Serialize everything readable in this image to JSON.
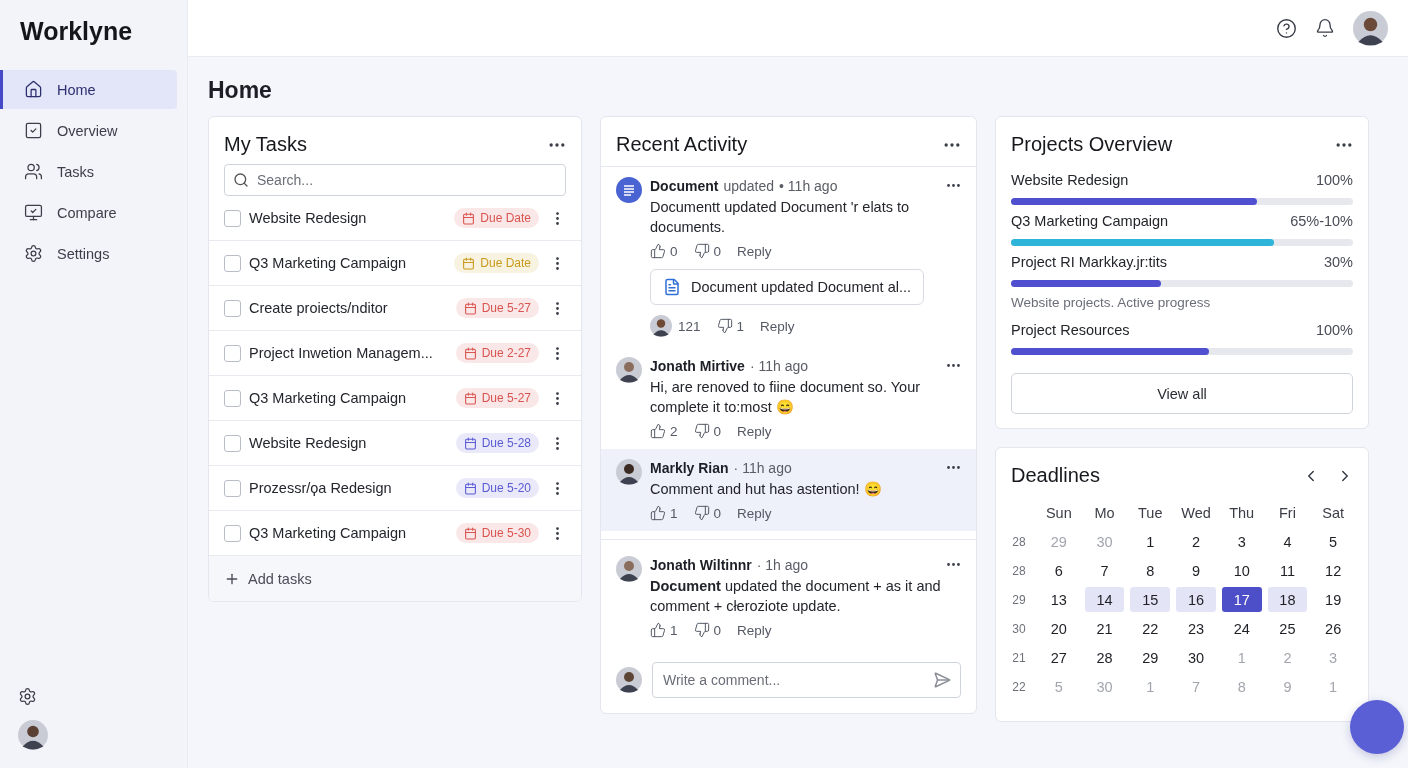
{
  "brand": "Worklyne",
  "nav": [
    {
      "label": "Home",
      "selected": true
    },
    {
      "label": "Overview",
      "selected": false
    },
    {
      "label": "Tasks",
      "selected": false
    },
    {
      "label": "Compare",
      "selected": false
    },
    {
      "label": "Settings",
      "selected": false
    }
  ],
  "page_title": "Home",
  "tasks": {
    "title": "My Tasks",
    "search": {
      "placeholder": "Search..."
    },
    "items": [
      {
        "name": "Website Redesign",
        "due": "Due Date",
        "color": "#d9534f",
        "checked": false
      },
      {
        "name": "Q3 Marketing Campaign",
        "due": "Due Date",
        "color": "#c99a1c",
        "checked": false
      },
      {
        "name": "Create proiects/nditor",
        "due": "Due 5-27",
        "color": "#d9534f",
        "checked": false
      },
      {
        "name": "Project Inwetion Managem...",
        "due": "Due 2-27",
        "color": "#d9534f",
        "checked": false
      },
      {
        "name": "Q3 Marketing Campaign",
        "due": "Due 5-27",
        "color": "#d9534f",
        "checked": false
      },
      {
        "name": "Website Redesign",
        "due": "Due 5-28",
        "color": "#5b5bd6",
        "checked": false
      },
      {
        "name": "Prozessr/ϙa Redesign",
        "due": "Due 5-20",
        "color": "#5b5bd6",
        "checked": false
      },
      {
        "name": "Q3 Marketing Campaign",
        "due": "Due 5-30",
        "color": "#d9534f",
        "checked": false
      }
    ],
    "add_label": "Add tasks"
  },
  "activity": {
    "title": "Recent Activity",
    "items": [
      {
        "kind": "document",
        "author": "Document",
        "action": "updated",
        "time": "• 11h ago",
        "text": "Documentt updated Document 'r elats to documents.",
        "likes": "0",
        "dislikes": "0",
        "reply": "Reply",
        "highlighted": false,
        "attachment": "Document updated Document al...",
        "sub": {
          "likes": "121",
          "dislikes": "1",
          "reply": "Reply"
        }
      },
      {
        "kind": "comment",
        "author": "Jonath Mirtive",
        "time": "· 11h ago",
        "text": "Hi, are renoved to fiine document so. Your complete it to:most 😄",
        "likes": "2",
        "dislikes": "0",
        "reply": "Reply",
        "highlighted": false
      },
      {
        "kind": "comment",
        "author": "Markly Rian",
        "time": "· 11h ago",
        "text": "Comment and hut has astention! 😄",
        "likes": "1",
        "dislikes": "0",
        "reply": "Reply",
        "highlighted": true
      },
      {
        "kind": "comment",
        "author": "Jonath Wiltinnr",
        "time": "· 1h ago",
        "text": "**Document** updated the document + as it and comment + cłeroziote update.",
        "likes": "1",
        "dislikes": "0",
        "reply": "Reply",
        "highlighted": false
      }
    ],
    "comment": {
      "placeholder": "Write a comment..."
    }
  },
  "projects": {
    "title": "Projects Overview",
    "items": [
      {
        "kind": "progress",
        "name": "Website Redesign",
        "value": "100%",
        "level": 0.72,
        "color": "#4f4fd0"
      },
      {
        "kind": "progress",
        "name": "Q3 Marketing Campaign",
        "value": "65%-10%",
        "level": 0.77,
        "color": "#2eb3d9"
      },
      {
        "kind": "progress",
        "name": "Project RI Markkay.jr:tits",
        "value": "30%",
        "level": 0.44,
        "color": "#4f4fd0"
      },
      {
        "kind": "note",
        "text": "Website projects.  Active progress"
      },
      {
        "kind": "progress",
        "name": "Project Resources",
        "value": "100%",
        "level": 0.58,
        "color": "#4f4fd0"
      }
    ],
    "button": "View all"
  },
  "calendar": {
    "title": "Deadlines",
    "weekdays": [
      "Sun",
      "Mo",
      "Tue",
      "Wed",
      "Thu",
      "Fri",
      "Sat"
    ],
    "weeks": [
      {
        "number": "28",
        "days": [
          {
            "label": "29",
            "muted": true,
            "in_range": false,
            "selected": false
          },
          {
            "label": "30",
            "muted": true,
            "in_range": false,
            "selected": false
          },
          {
            "label": "1",
            "muted": false,
            "in_range": false,
            "selected": false
          },
          {
            "label": "2",
            "muted": false,
            "in_range": false,
            "selected": false
          },
          {
            "label": "3",
            "muted": false,
            "in_range": false,
            "selected": false
          },
          {
            "label": "4",
            "muted": false,
            "in_range": false,
            "selected": false
          },
          {
            "label": "5",
            "muted": false,
            "in_range": false,
            "selected": false
          }
        ]
      },
      {
        "number": "28",
        "days": [
          {
            "label": "6",
            "muted": false,
            "in_range": false,
            "selected": false
          },
          {
            "label": "7",
            "muted": false,
            "in_range": false,
            "selected": false
          },
          {
            "label": "8",
            "muted": false,
            "in_range": false,
            "selected": false
          },
          {
            "label": "9",
            "muted": false,
            "in_range": false,
            "selected": false
          },
          {
            "label": "10",
            "muted": false,
            "in_range": false,
            "selected": false
          },
          {
            "label": "11",
            "muted": false,
            "in_range": false,
            "selected": false
          },
          {
            "label": "12",
            "muted": false,
            "in_range": false,
            "selected": false
          }
        ]
      },
      {
        "number": "29",
        "days": [
          {
            "label": "13",
            "muted": false,
            "in_range": false,
            "selected": false
          },
          {
            "label": "14",
            "muted": false,
            "in_range": true,
            "selected": false
          },
          {
            "label": "15",
            "muted": false,
            "in_range": true,
            "selected": false
          },
          {
            "label": "16",
            "muted": false,
            "in_range": true,
            "selected": false
          },
          {
            "label": "17",
            "muted": false,
            "in_range": true,
            "selected": true
          },
          {
            "label": "18",
            "muted": false,
            "in_range": true,
            "selected": false
          },
          {
            "label": "19",
            "muted": false,
            "in_range": false,
            "selected": false
          }
        ]
      },
      {
        "number": "30",
        "days": [
          {
            "label": "20",
            "muted": false,
            "in_range": false,
            "selected": false
          },
          {
            "label": "21",
            "muted": false,
            "in_range": false,
            "selected": false
          },
          {
            "label": "22",
            "muted": false,
            "in_range": false,
            "selected": false
          },
          {
            "label": "23",
            "muted": false,
            "in_range": false,
            "selected": false
          },
          {
            "label": "24",
            "muted": false,
            "in_range": false,
            "selected": false
          },
          {
            "label": "25",
            "muted": false,
            "in_range": false,
            "selected": false
          },
          {
            "label": "26",
            "muted": false,
            "in_range": false,
            "selected": false
          }
        ]
      },
      {
        "number": "21",
        "days": [
          {
            "label": "27",
            "muted": false,
            "in_range": false,
            "selected": false
          },
          {
            "label": "28",
            "muted": false,
            "in_range": false,
            "selected": false
          },
          {
            "label": "29",
            "muted": false,
            "in_range": false,
            "selected": false
          },
          {
            "label": "30",
            "muted": false,
            "in_range": false,
            "selected": false
          },
          {
            "label": "1",
            "muted": true,
            "in_range": false,
            "selected": false
          },
          {
            "label": "2",
            "muted": true,
            "in_range": false,
            "selected": false
          },
          {
            "label": "3",
            "muted": true,
            "in_range": false,
            "selected": false
          }
        ]
      },
      {
        "number": "22",
        "days": [
          {
            "label": "5",
            "muted": true,
            "in_range": false,
            "selected": false
          },
          {
            "label": "30",
            "muted": true,
            "in_range": false,
            "selected": false
          },
          {
            "label": "1",
            "muted": true,
            "in_range": false,
            "selected": false
          },
          {
            "label": "7",
            "muted": true,
            "in_range": false,
            "selected": false
          },
          {
            "label": "8",
            "muted": true,
            "in_range": false,
            "selected": false
          },
          {
            "label": "9",
            "muted": true,
            "in_range": false,
            "selected": false
          },
          {
            "label": "1",
            "muted": true,
            "in_range": false,
            "selected": false
          }
        ]
      }
    ]
  }
}
